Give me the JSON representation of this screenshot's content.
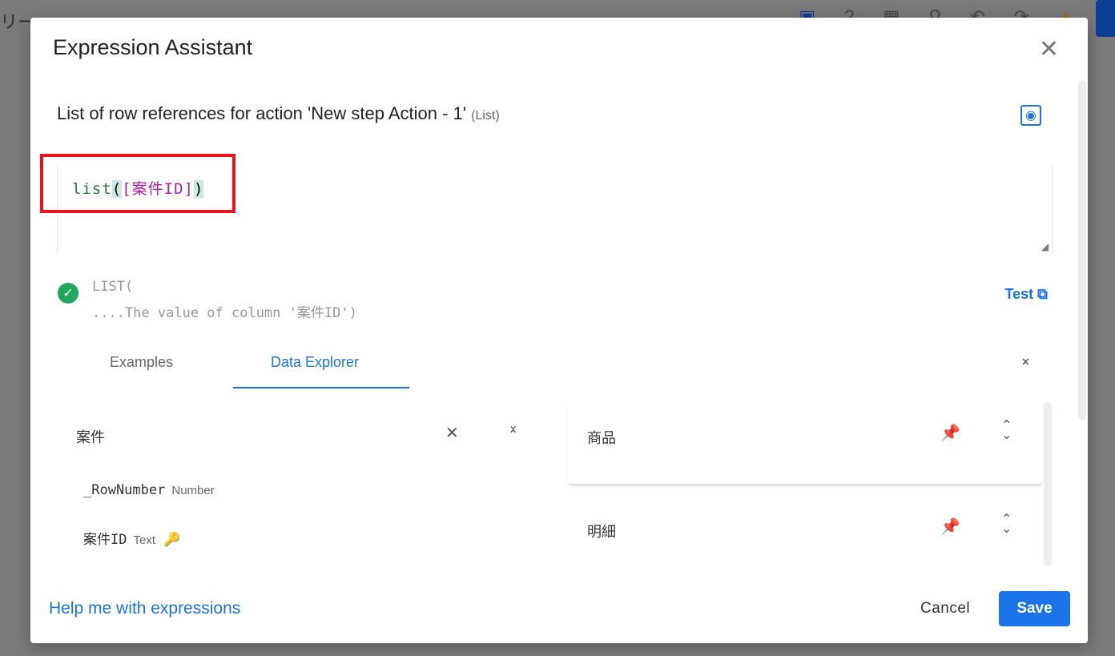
{
  "background": {
    "partial_title": "リー"
  },
  "modal": {
    "title": "Expression Assistant",
    "subtitle": "List of row references for action 'New step Action - 1'",
    "subtitle_type": "(List)",
    "expression": {
      "fn": "list",
      "open": "(",
      "column": "[案件ID]",
      "close": ")"
    },
    "validation": {
      "line1": "LIST(",
      "line2": "....The value of column '案件ID')",
      "status": "valid"
    },
    "test_label": "Test",
    "tabs": [
      {
        "label": "Examples",
        "active": false
      },
      {
        "label": "Data Explorer",
        "active": true
      }
    ],
    "tables": [
      {
        "name": "案件",
        "pinned": false,
        "expanded": true,
        "fields": [
          {
            "name": "_RowNumber",
            "type": "Number",
            "key": false
          },
          {
            "name": "案件ID",
            "type": "Text",
            "key": true
          }
        ]
      },
      {
        "name": "商品",
        "pinned": true,
        "expanded": false
      },
      {
        "name": "明細",
        "pinned": true,
        "expanded": false
      }
    ],
    "help_link": "Help me with expressions",
    "cancel_label": "Cancel",
    "save_label": "Save"
  },
  "colors": {
    "accent": "#1a73e8",
    "valid": "#1fa85a",
    "highlight_box": "#e8141d"
  }
}
